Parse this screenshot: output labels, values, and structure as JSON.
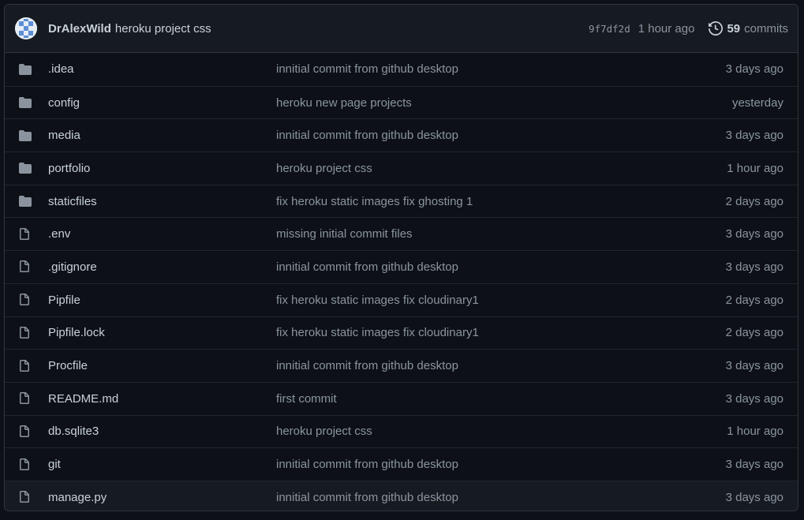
{
  "header": {
    "author": "DrAlexWild",
    "message": "heroku project css",
    "sha": "9f7df2d",
    "time": "1 hour ago",
    "commit_count": "59",
    "commits_label": "commits"
  },
  "files": [
    {
      "name": ".idea",
      "type": "folder",
      "message": "innitial commit from github desktop",
      "time": "3 days ago"
    },
    {
      "name": "config",
      "type": "folder",
      "message": "heroku new page projects",
      "time": "yesterday"
    },
    {
      "name": "media",
      "type": "folder",
      "message": "innitial commit from github desktop",
      "time": "3 days ago"
    },
    {
      "name": "portfolio",
      "type": "folder",
      "message": "heroku project css",
      "time": "1 hour ago"
    },
    {
      "name": "staticfiles",
      "type": "folder",
      "message": "fix heroku static images fix ghosting 1",
      "time": "2 days ago"
    },
    {
      "name": ".env",
      "type": "file",
      "message": "missing initial commit files",
      "time": "3 days ago"
    },
    {
      "name": ".gitignore",
      "type": "file",
      "message": "innitial commit from github desktop",
      "time": "3 days ago"
    },
    {
      "name": "Pipfile",
      "type": "file",
      "message": "fix heroku static images fix cloudinary1",
      "time": "2 days ago"
    },
    {
      "name": "Pipfile.lock",
      "type": "file",
      "message": "fix heroku static images fix cloudinary1",
      "time": "2 days ago"
    },
    {
      "name": "Procfile",
      "type": "file",
      "message": "innitial commit from github desktop",
      "time": "3 days ago"
    },
    {
      "name": "README.md",
      "type": "file",
      "message": "first commit",
      "time": "3 days ago"
    },
    {
      "name": "db.sqlite3",
      "type": "file",
      "message": "heroku project css",
      "time": "1 hour ago"
    },
    {
      "name": "git",
      "type": "file",
      "message": "innitial commit from github desktop",
      "time": "3 days ago"
    },
    {
      "name": "manage.py",
      "type": "file",
      "message": "innitial commit from github desktop",
      "time": "3 days ago"
    }
  ],
  "colors": {
    "folder_icon": "#8b949e",
    "file_icon": "#8b949e",
    "background": "#0d1117",
    "header_bg": "#161b22"
  }
}
